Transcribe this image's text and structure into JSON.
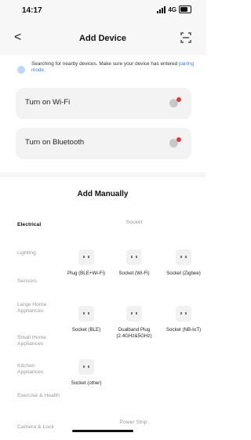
{
  "status": {
    "time": "14:17",
    "network": "4G"
  },
  "header": {
    "back_label": "<",
    "title": "Add Device"
  },
  "search": {
    "message": "Searching for nearby devices. Make sure your device has entered",
    "link": "pairing mode."
  },
  "cards": [
    {
      "label": "Turn on Wi-Fi"
    },
    {
      "label": "Turn on Bluetooth"
    }
  ],
  "section_title": "Add Manually",
  "categories": [
    {
      "label": "Electrical",
      "active": true
    },
    {
      "label": "Lighting"
    },
    {
      "label": "Sensors"
    },
    {
      "label": "Large Home Appliances"
    },
    {
      "label": "Small Home Appliances"
    },
    {
      "label": "Kitchen Appliances"
    },
    {
      "label": "Exercise & Health"
    },
    {
      "label": "Camera & Lock"
    }
  ],
  "content": {
    "group_socket": "Socket",
    "group_power_strip": "Power Strip",
    "devices": [
      {
        "name": "Plug (BLE+Wi-Fi)"
      },
      {
        "name": "Socket (Wi-Fi)"
      },
      {
        "name": "Socket (Zigbee)"
      },
      {
        "name": "Socket (BLE)"
      },
      {
        "name": "Dualband Plug (2.4GHz&5GHz)"
      },
      {
        "name": "Socket (NB-IoT)"
      },
      {
        "name": "Socket (other)"
      }
    ]
  },
  "colors": {
    "accent": "#3d7be8",
    "alert": "#e53935"
  }
}
